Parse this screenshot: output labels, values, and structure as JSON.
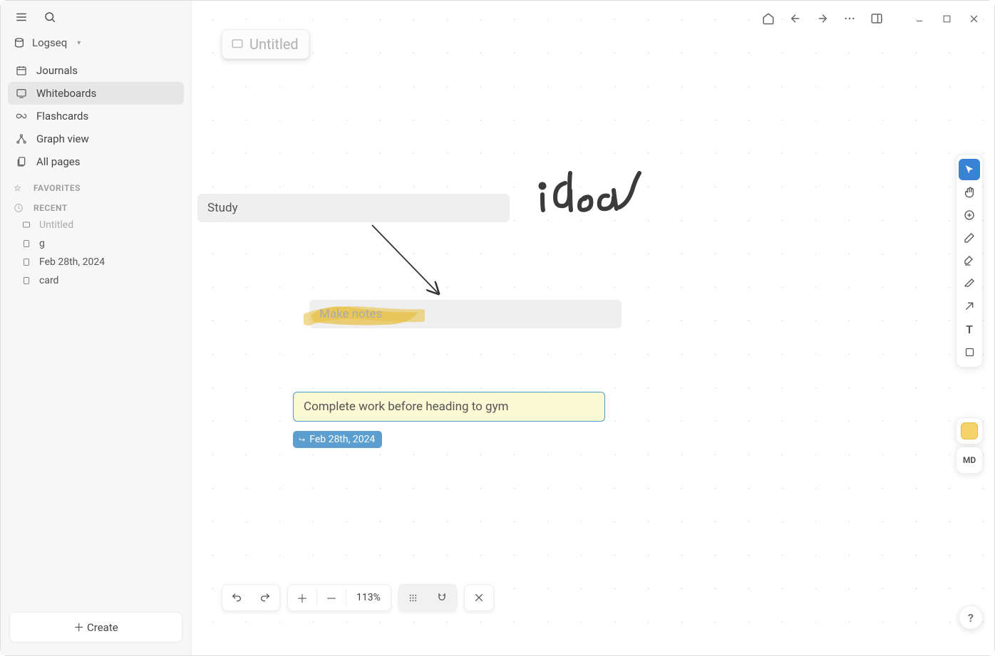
{
  "graph_name": "Logseq",
  "nav": {
    "journals": "Journals",
    "whiteboards": "Whiteboards",
    "flashcards": "Flashcards",
    "graph_view": "Graph view",
    "all_pages": "All pages"
  },
  "sections": {
    "favorites": "FAVORITES",
    "recent": "RECENT"
  },
  "recent": [
    {
      "label": "Untitled",
      "type": "whiteboard",
      "dim": true
    },
    {
      "label": "g",
      "type": "page"
    },
    {
      "label": "Feb 28th, 2024",
      "type": "page"
    },
    {
      "label": "card",
      "type": "page"
    }
  ],
  "create_label": "Create",
  "whiteboard": {
    "title": "Untitled",
    "nodes": {
      "study": "Study",
      "make_notes": "Make notes",
      "task": "Complete work before heading to gym"
    },
    "date_chip": "Feb 28th, 2024",
    "handwriting": "idea"
  },
  "zoom": {
    "level": "113%"
  },
  "tools": {
    "select": "Select",
    "pan": "Pan",
    "add_block": "Add block",
    "draw": "Draw",
    "highlight": "Highlight",
    "erase": "Eraser",
    "connector": "Connector",
    "text": "Text",
    "shape": "Shape"
  },
  "mode_chip": "MD",
  "color_swatch": "#f6d46b",
  "help": "?"
}
